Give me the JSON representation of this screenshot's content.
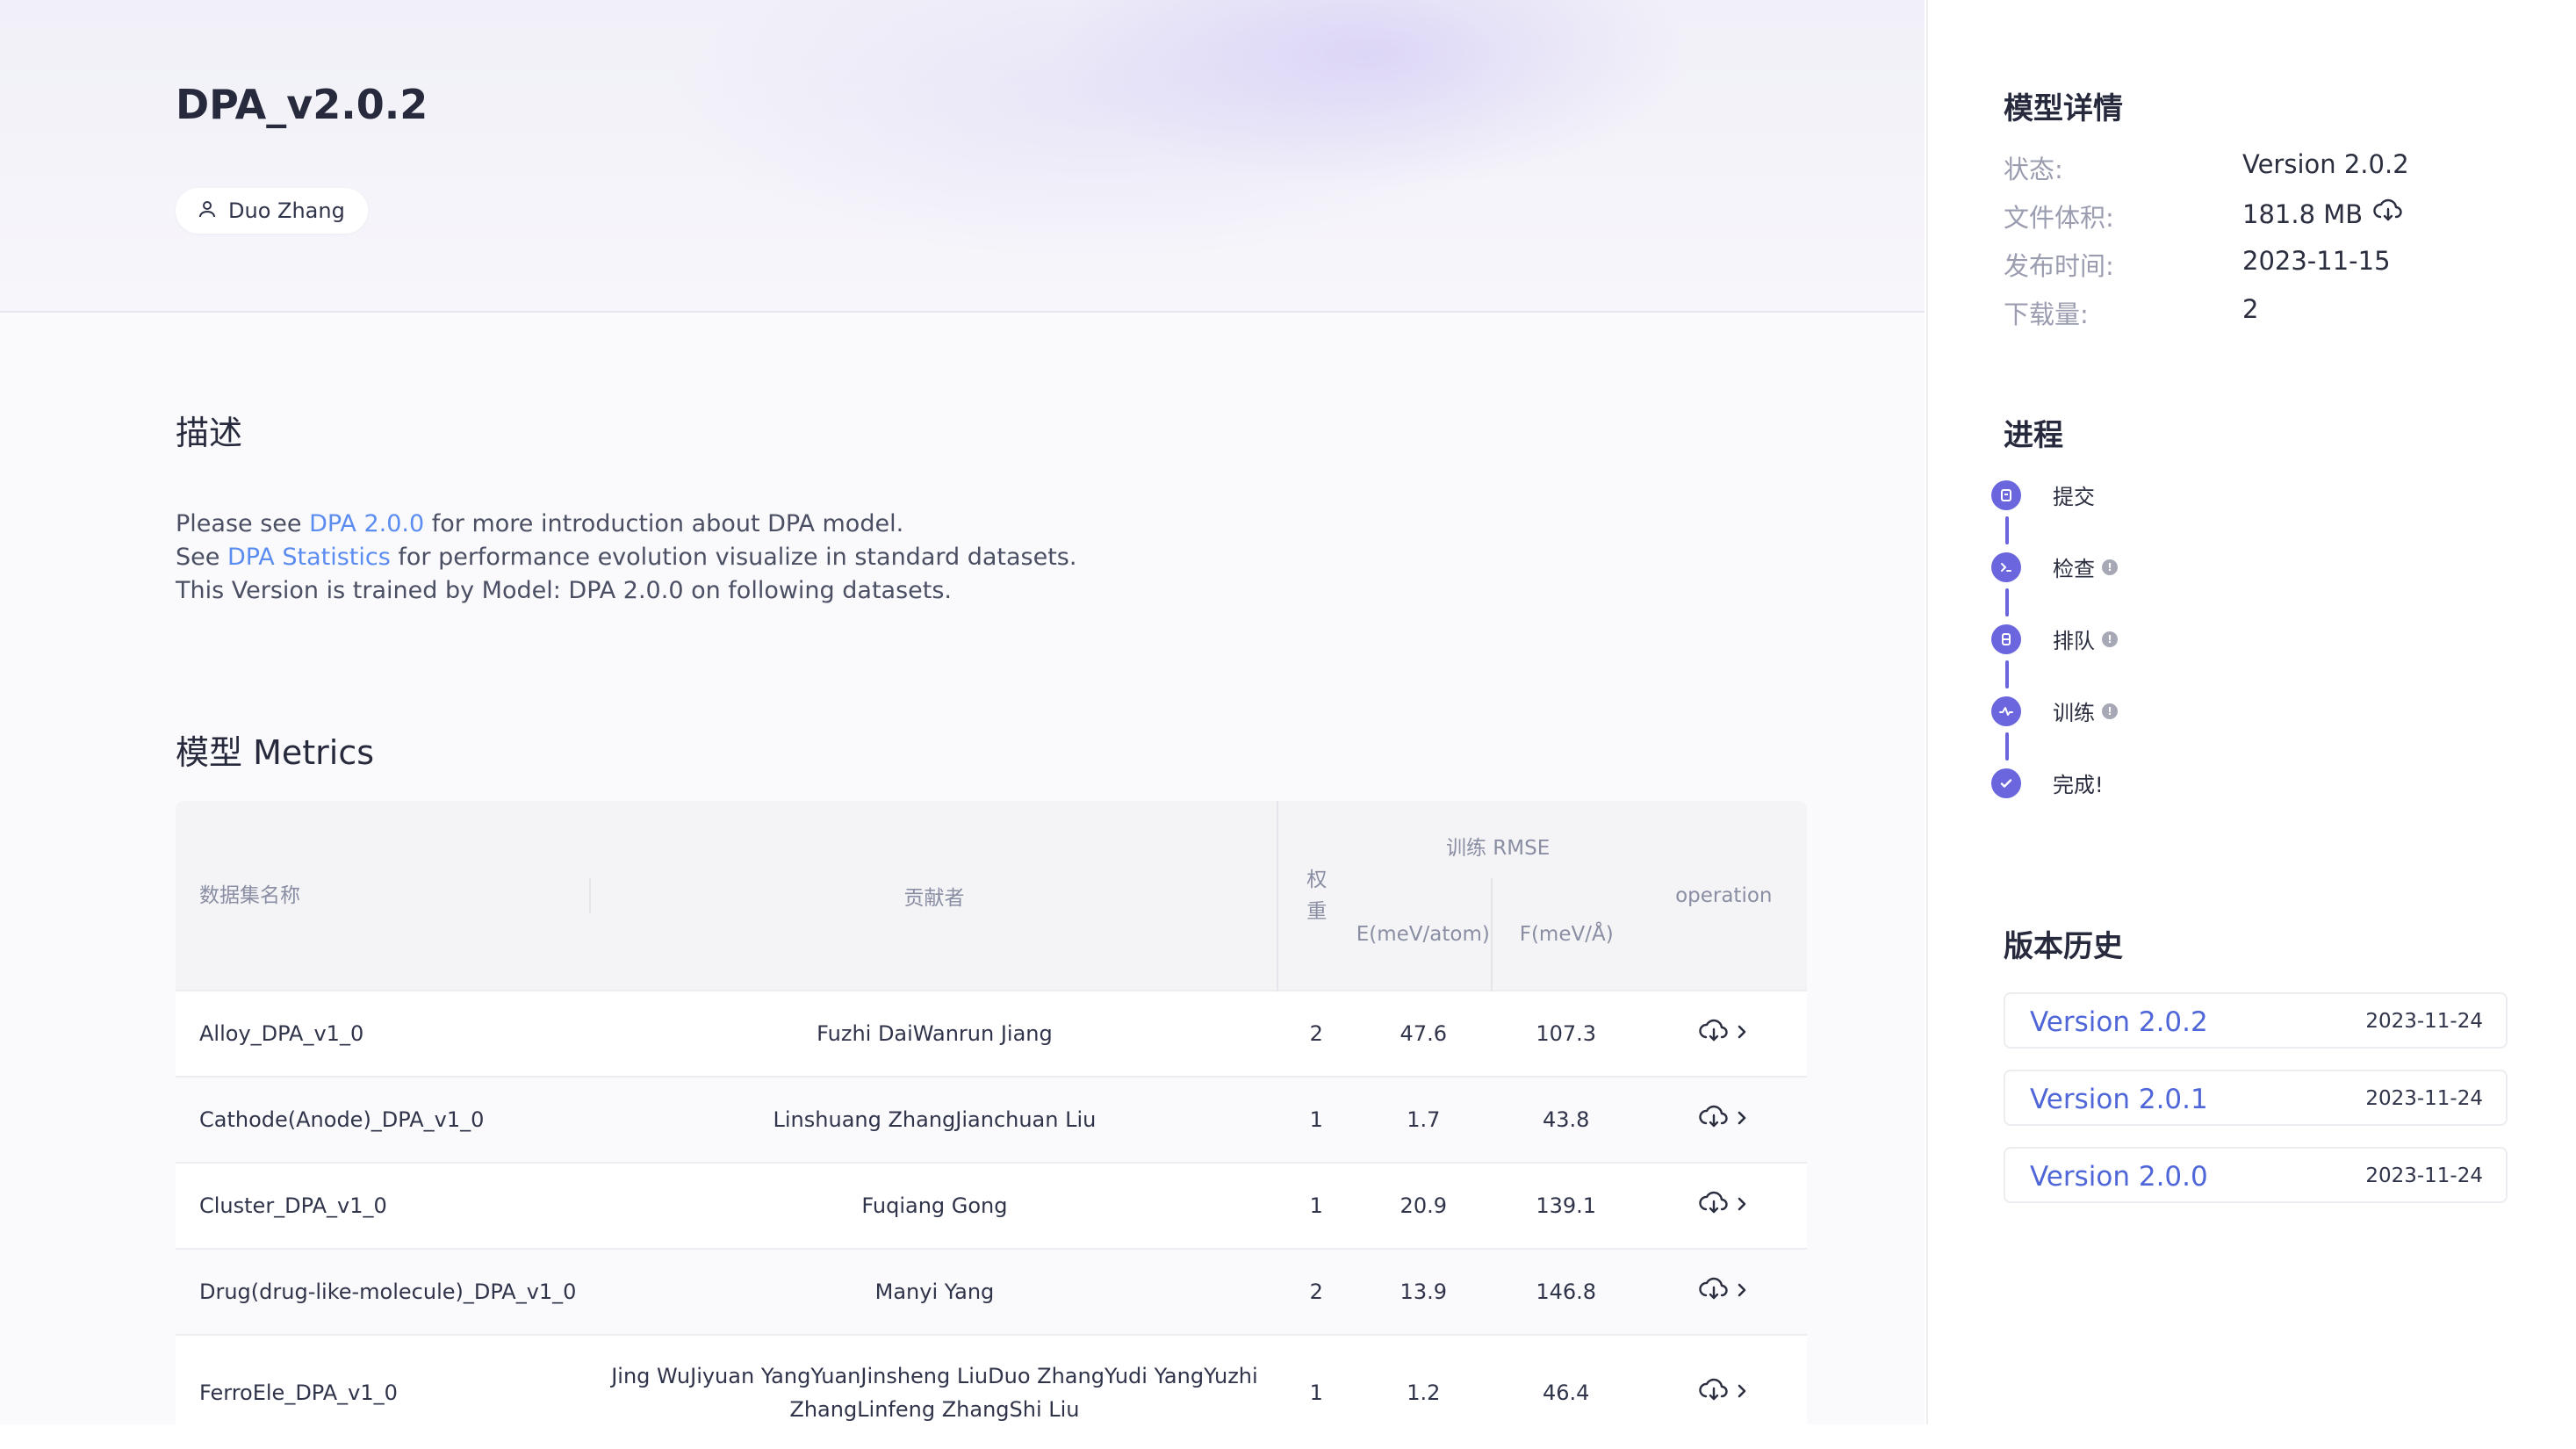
{
  "model": {
    "title": "DPA_v2.0.2",
    "author": "Duo Zhang"
  },
  "description": {
    "heading": "描述",
    "line1_pre": "Please see ",
    "line1_link": "DPA 2.0.0",
    "line1_post": " for more introduction about DPA model.",
    "line2_pre": "See ",
    "line2_link": "DPA Statistics",
    "line2_post": " for performance evolution visualize in standard datasets.",
    "line3": "This Version is trained by Model: DPA 2.0.0 on following datasets."
  },
  "metrics": {
    "heading": "模型 Metrics",
    "headers": {
      "dataset": "数据集名称",
      "contributor": "贡献者",
      "weight": "权重",
      "rmse_group": "训练 RMSE",
      "energy": "E(meV/atom)",
      "force": "F(meV/Å)",
      "operation": "operation"
    },
    "rows": [
      {
        "dataset": "Alloy_DPA_v1_0",
        "contributor": "Fuzhi DaiWanrun Jiang",
        "weight": "2",
        "energy": "47.6",
        "force": "107.3"
      },
      {
        "dataset": "Cathode(Anode)_DPA_v1_0",
        "contributor": "Linshuang ZhangJianchuan Liu",
        "weight": "1",
        "energy": "1.7",
        "force": "43.8"
      },
      {
        "dataset": "Cluster_DPA_v1_0",
        "contributor": "Fuqiang Gong",
        "weight": "1",
        "energy": "20.9",
        "force": "139.1"
      },
      {
        "dataset": "Drug(drug-like-molecule)_DPA_v1_0",
        "contributor": "Manyi Yang",
        "weight": "2",
        "energy": "13.9",
        "force": "146.8"
      },
      {
        "dataset": "FerroEle_DPA_v1_0",
        "contributor": "Jing WuJiyuan YangYuanJinsheng LiuDuo ZhangYudi YangYuzhi ZhangLinfeng ZhangShi Liu",
        "weight": "1",
        "energy": "1.2",
        "force": "46.4"
      }
    ]
  },
  "details": {
    "heading": "模型详情",
    "status_label": "状态:",
    "status_value": "Version 2.0.2",
    "size_label": "文件体积:",
    "size_value": "181.8 MB",
    "date_label": "发布时间:",
    "date_value": "2023-11-15",
    "downloads_label": "下载量:",
    "downloads_value": "2"
  },
  "progress": {
    "heading": "进程",
    "steps": [
      {
        "label": "提交",
        "icon": "document-icon"
      },
      {
        "label": "检查",
        "icon": "terminal-icon"
      },
      {
        "label": "排队",
        "icon": "queue-icon"
      },
      {
        "label": "训练",
        "icon": "activity-icon"
      },
      {
        "label": "完成!",
        "icon": "check-icon"
      }
    ]
  },
  "history": {
    "heading": "版本历史",
    "versions": [
      {
        "name": "Version 2.0.2",
        "date": "2023-11-24"
      },
      {
        "name": "Version 2.0.1",
        "date": "2023-11-24"
      },
      {
        "name": "Version 2.0.0",
        "date": "2023-11-24"
      }
    ]
  },
  "colors": {
    "accent": "#6b66de",
    "link": "#5b8cf0",
    "version_link": "#4f66d8"
  }
}
